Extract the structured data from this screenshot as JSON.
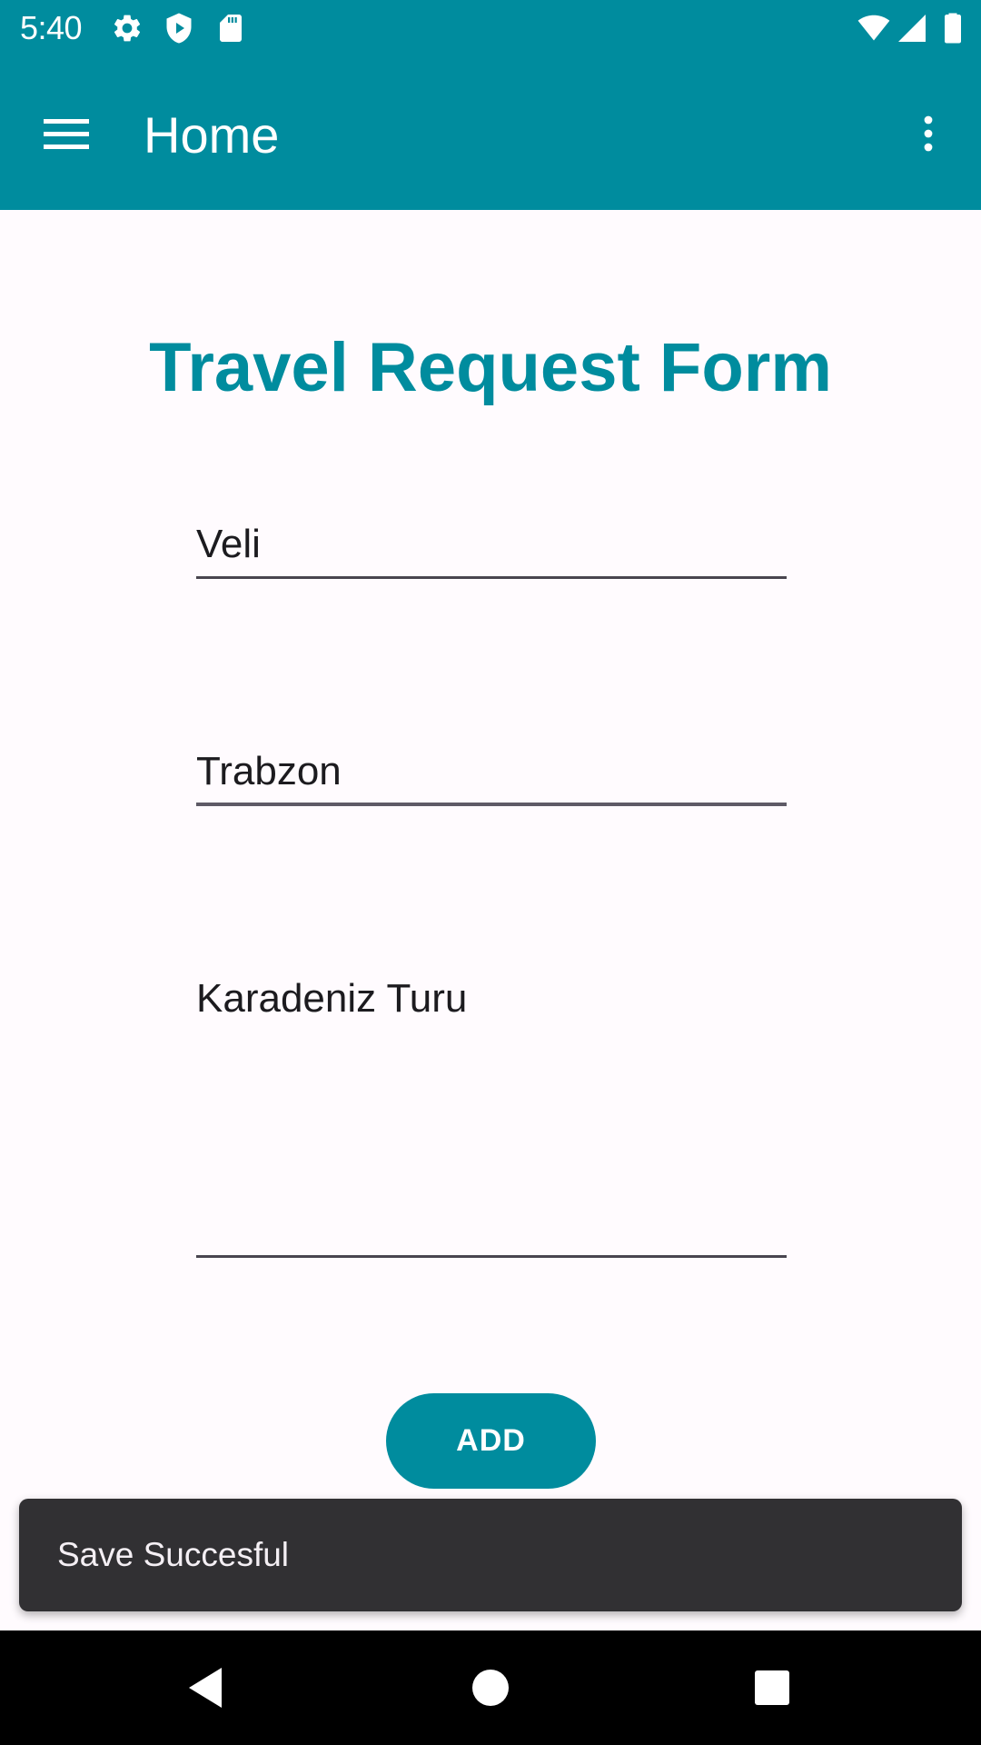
{
  "status_bar": {
    "time": "5:40",
    "left_icons": [
      "settings-icon",
      "shield-play-icon",
      "sd-card-icon"
    ],
    "right_icons": [
      "wifi-icon",
      "signal-icon",
      "battery-icon"
    ]
  },
  "app_bar": {
    "title": "Home",
    "menu_icon": "hamburger-menu-icon",
    "overflow_icon": "more-vert-icon",
    "background": "#008C9E"
  },
  "form": {
    "title": "Travel Request Form",
    "name_value": "Veli",
    "city_value": "Trabzon",
    "tour_value": "Karadeniz Turu",
    "add_label": "ADD"
  },
  "snackbar": {
    "message": "Save Succesful"
  },
  "nav_bar": {
    "buttons": [
      "back-icon",
      "home-icon",
      "recents-icon"
    ]
  },
  "colors": {
    "accent": "#008C9E",
    "background": "#FFFBFE",
    "snackbar": "#313033"
  }
}
